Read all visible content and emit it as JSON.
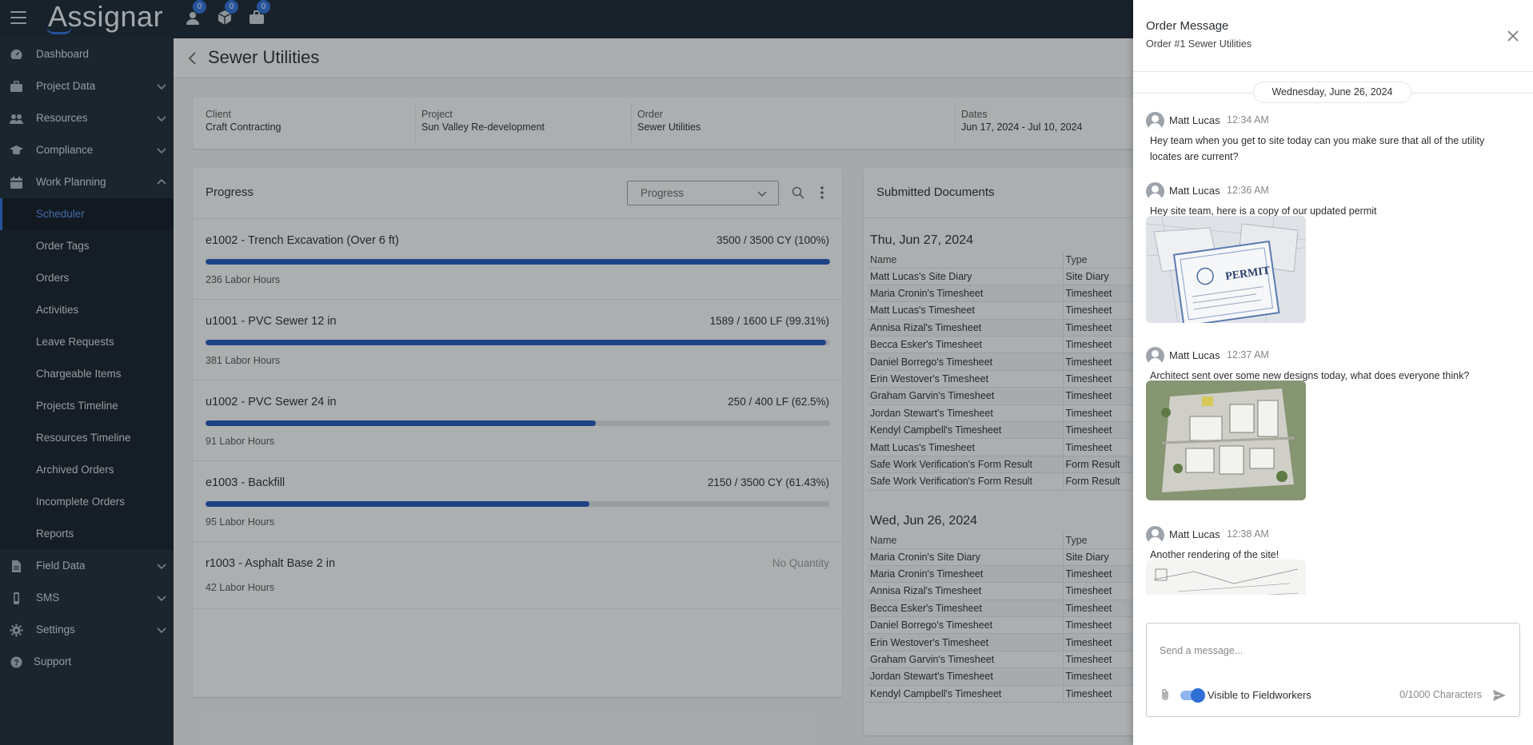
{
  "app": {
    "logo": "Assignar"
  },
  "topbar": {
    "icons": [
      {
        "name": "user-icon",
        "badge": "0"
      },
      {
        "name": "box-icon",
        "badge": "0"
      },
      {
        "name": "briefcase-icon",
        "badge": "0"
      }
    ]
  },
  "sidebar": {
    "items": [
      {
        "label": "Dashboard",
        "icon": "dashboard-icon"
      },
      {
        "label": "Project Data",
        "icon": "briefcase-icon",
        "expandable": true
      },
      {
        "label": "Resources",
        "icon": "resources-icon",
        "expandable": true
      },
      {
        "label": "Compliance",
        "icon": "graduation-cap-icon",
        "expandable": true
      },
      {
        "label": "Work Planning",
        "icon": "calendar-icon",
        "expanded": true
      },
      {
        "label": "Field Data",
        "icon": "file-icon",
        "expandable": true
      },
      {
        "label": "SMS",
        "icon": "phone-icon",
        "expandable": true
      },
      {
        "label": "Settings",
        "icon": "gear-icon",
        "expandable": true
      },
      {
        "label": "Support",
        "icon": "help-icon"
      }
    ],
    "work_planning_children": [
      "Scheduler",
      "Order Tags",
      "Orders",
      "Activities",
      "Leave Requests",
      "Chargeable Items",
      "Projects Timeline",
      "Resources Timeline",
      "Archived Orders",
      "Incomplete Orders",
      "Reports"
    ],
    "active_child": "Scheduler"
  },
  "page": {
    "title": "Sewer Utilities"
  },
  "info": {
    "client_label": "Client",
    "client": "Craft Contracting",
    "project_label": "Project",
    "project": "Sun Valley Re-development",
    "order_label": "Order",
    "order": "Sewer Utilities",
    "dates_label": "Dates",
    "dates": "Jun 17, 2024 - Jul 10, 2024"
  },
  "progress": {
    "title": "Progress",
    "select_value": "Progress",
    "rows": [
      {
        "name": "e1002 - Trench Excavation (Over 6 ft)",
        "qty": "3500 / 3500 CY (100%)",
        "pct": 100,
        "hours": "236 Labor Hours"
      },
      {
        "name": "u1001 - PVC Sewer 12 in",
        "qty": "1589 / 1600 LF (99.31%)",
        "pct": 99.31,
        "hours": "381 Labor Hours"
      },
      {
        "name": "u1002 - PVC Sewer 24 in",
        "qty": "250 / 400 LF (62.5%)",
        "pct": 62.5,
        "hours": "91 Labor Hours"
      },
      {
        "name": "e1003 - Backfill",
        "qty": "2150 / 3500 CY (61.43%)",
        "pct": 61.43,
        "hours": "95 Labor Hours"
      },
      {
        "name": "r1003 - Asphalt Base 2 in",
        "qty": "No Quantity",
        "pct": null,
        "hours": "42 Labor Hours"
      }
    ]
  },
  "documents": {
    "title": "Submitted Documents",
    "col_name": "Name",
    "col_type": "Type",
    "groups": [
      {
        "date": "Thu, Jun 27, 2024",
        "rows": [
          [
            "Matt Lucas's Site Diary",
            "Site Diary"
          ],
          [
            "Maria Cronin's Timesheet",
            "Timesheet"
          ],
          [
            "Matt Lucas's Timesheet",
            "Timesheet"
          ],
          [
            "Annisa Rizal's Timesheet",
            "Timesheet"
          ],
          [
            "Becca Esker's Timesheet",
            "Timesheet"
          ],
          [
            "Daniel Borrego's Timesheet",
            "Timesheet"
          ],
          [
            "Erin Westover's Timesheet",
            "Timesheet"
          ],
          [
            "Graham Garvin's Timesheet",
            "Timesheet"
          ],
          [
            "Jordan Stewart's Timesheet",
            "Timesheet"
          ],
          [
            "Kendyl Campbell's Timesheet",
            "Timesheet"
          ],
          [
            "Matt Lucas's Timesheet",
            "Timesheet"
          ],
          [
            "Safe Work Verification's Form Result",
            "Form Result"
          ],
          [
            "Safe Work Verification's Form Result",
            "Form Result"
          ]
        ]
      },
      {
        "date": "Wed, Jun 26, 2024",
        "rows": [
          [
            "Maria Cronin's Site Diary",
            "Site Diary"
          ],
          [
            "Maria Cronin's Timesheet",
            "Timesheet"
          ],
          [
            "Annisa Rizal's Timesheet",
            "Timesheet"
          ],
          [
            "Becca Esker's Timesheet",
            "Timesheet"
          ],
          [
            "Daniel Borrego's Timesheet",
            "Timesheet"
          ],
          [
            "Erin Westover's Timesheet",
            "Timesheet"
          ],
          [
            "Graham Garvin's Timesheet",
            "Timesheet"
          ],
          [
            "Jordan Stewart's Timesheet",
            "Timesheet"
          ],
          [
            "Kendyl Campbell's Timesheet",
            "Timesheet"
          ]
        ]
      }
    ]
  },
  "drawer": {
    "title": "Order Message",
    "subtitle": "Order #1 Sewer Utilities",
    "date_pill": "Wednesday, June 26, 2024",
    "messages": [
      {
        "author": "Matt Lucas",
        "time": "12:34 AM",
        "text": "Hey team when you get to site today can you make sure that all of the utility locates are current?",
        "image": null
      },
      {
        "author": "Matt Lucas",
        "time": "12:36 AM",
        "text": "Hey site team, here is a copy of our updated permit",
        "image": "permit"
      },
      {
        "author": "Matt Lucas",
        "time": "12:37 AM",
        "text": "Architect sent over some new designs today, what does everyone think?",
        "image": "site-plan"
      },
      {
        "author": "Matt Lucas",
        "time": "12:38 AM",
        "text": "Another rendering of the site!",
        "image": "rendering"
      }
    ],
    "permit_label": "PERMIT",
    "composer": {
      "placeholder": "Send a message...",
      "toggle_label": "Visible to Fieldworkers",
      "toggle_on": true,
      "char_count": "0/1000 Characters"
    }
  },
  "colors": {
    "accent": "#2f6fd6",
    "progress_fill": "#2458b7",
    "sidebar_bg": "#1f2b37"
  }
}
